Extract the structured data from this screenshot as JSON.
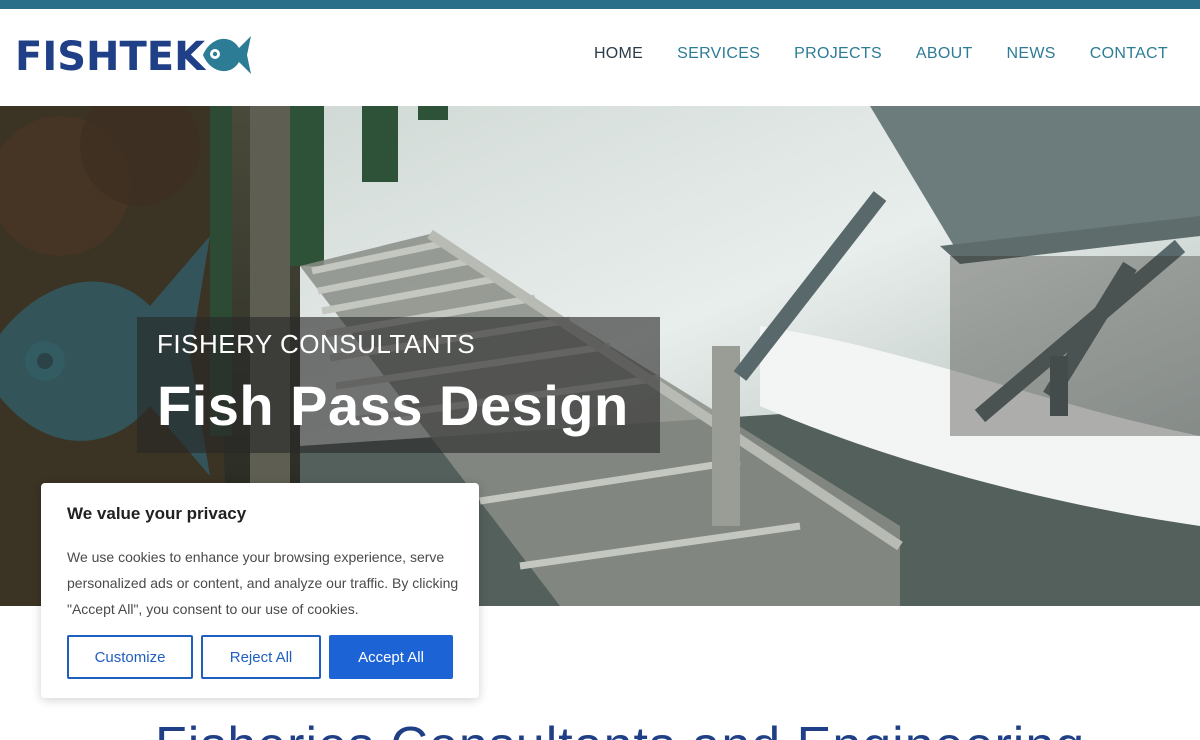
{
  "brand": {
    "logo_text": "FISHTEK",
    "colors": {
      "primary": "#1f3f86",
      "accent": "#2d7c95",
      "top_strip": "#2a6f8a"
    }
  },
  "nav": {
    "items": [
      {
        "label": "HOME",
        "active": true
      },
      {
        "label": "SERVICES",
        "active": false
      },
      {
        "label": "PROJECTS",
        "active": false
      },
      {
        "label": "ABOUT",
        "active": false
      },
      {
        "label": "NEWS",
        "active": false
      },
      {
        "label": "CONTACT",
        "active": false
      }
    ]
  },
  "hero": {
    "eyebrow": "FISHERY CONSULTANTS",
    "title": "Fish Pass Design",
    "image_icon": "fish-pass-photo"
  },
  "main": {
    "heading": "Fisheries Consultants and Engineering"
  },
  "cookie_banner": {
    "title": "We value your privacy",
    "text": "We use cookies to enhance your browsing experience, serve personalized ads or content, and analyze our traffic. By clicking \"Accept All\", you consent to our use of cookies.",
    "customize_label": "Customize",
    "reject_label": "Reject All",
    "accept_label": "Accept All",
    "accent_color": "#1c64d6"
  }
}
